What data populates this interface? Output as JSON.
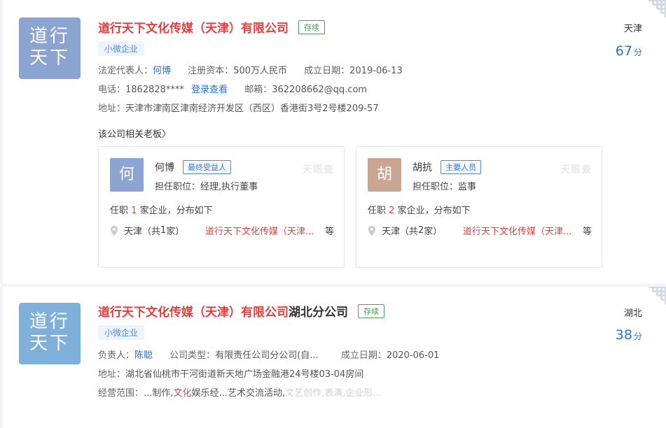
{
  "cards": [
    {
      "logo_line1": "道行",
      "logo_line2": "天下",
      "name": "道行天下文化传媒（天津）有限公司",
      "status": "存续",
      "scale": "小微企业",
      "legal_rep_label": "法定代表人：",
      "legal_rep": "何博",
      "capital_label": "注册资本：",
      "capital": "500万人民币",
      "est_label": "成立日期：",
      "est_date": "2019-06-13",
      "phone_label": "电话：",
      "phone": "1862828****",
      "phone_link": "登录查看",
      "email_label": "邮箱：",
      "email": "362208662@qq.com",
      "addr_label": "地址：",
      "address": "天津市津南区津南经济开发区（西区）香港街3号2号楼209-57",
      "region": "天津",
      "score": "67",
      "score_unit": "分",
      "boss_title": "该公司相关老板",
      "boss_chevron": "〉",
      "bosses": [
        {
          "avatar": "何",
          "name": "何博",
          "role": "最终受益人",
          "pos_label": "担任职位：",
          "position": "经理,执行董事",
          "watermark": "天眼查",
          "employ_pre": "任职",
          "employ_num": "1",
          "employ_post": "家企业，分布如下",
          "loc_pre": "天津（共",
          "loc_num": "1",
          "loc_post": "家）",
          "loc_company": "道行天下文化传媒（天津...",
          "loc_more": "等",
          "avatar_color": "#8ca4d1"
        },
        {
          "avatar": "胡",
          "name": "胡抗",
          "role": "主要人员",
          "pos_label": "担任职位：",
          "position": "监事",
          "watermark": "天眼查",
          "employ_pre": "任职",
          "employ_num": "2",
          "employ_post": "家企业，分布如下",
          "loc_pre": "天津（共",
          "loc_num": "2",
          "loc_post": "家）",
          "loc_company": "道行天下文化传媒（天津...",
          "loc_more": "等",
          "avatar_color": "#c9a594"
        }
      ]
    },
    {
      "logo_line1": "道行",
      "logo_line2": "天下",
      "name": "道行天下文化传媒（天津）有限公司",
      "name_suffix": "湖北分公司",
      "status": "存续",
      "scale": "小微企业",
      "manager_label": "负责人：",
      "manager": "陈聪",
      "type_label": "公司类型：",
      "type": "有限责任公司分公司(自...",
      "est_label": "成立日期：",
      "est_date": "2020-06-01",
      "addr_label": "地址：",
      "address": "湖北省仙桃市干河街道新天地广场金融港24号楼03-04房间",
      "scope_label": "经营范围：",
      "scope_pre": "...制作,",
      "scope_hl": "文化",
      "scope_post": "娱乐经...艺术交流活动,",
      "scope_blur": "文艺创作,表演,企业形...",
      "region": "湖北",
      "score": "38",
      "score_unit": "分"
    }
  ]
}
